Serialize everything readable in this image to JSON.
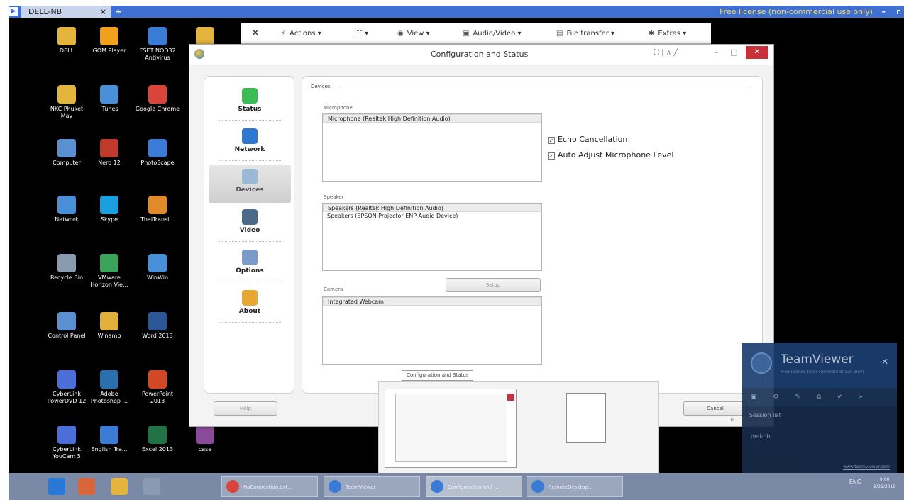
{
  "tv_bar": {
    "tab_label": "DELL-NB",
    "tab_close": "×",
    "new_tab": "+",
    "license_text": "Free license (non-commercial use only)",
    "minimize": "–",
    "maximize": "ñ"
  },
  "desktop_icons": [
    {
      "label": "DELL",
      "color": "#e4b53c"
    },
    {
      "label": "GOM Player",
      "color": "#f0a01a"
    },
    {
      "label": "ESET NOD32 Antivirus",
      "color": "#3a7bd5"
    },
    {
      "label": "",
      "color": "#e4b53c"
    },
    {
      "label": "NKC Phuket May",
      "color": "#e4b53c"
    },
    {
      "label": "iTunes",
      "color": "#4a90d9"
    },
    {
      "label": "Google Chrome",
      "color": "#d9453a"
    },
    {
      "label": "Computer",
      "color": "#5a8fd0"
    },
    {
      "label": "Nero 12",
      "color": "#c0392b"
    },
    {
      "label": "PhotoScape",
      "color": "#3a7bd5"
    },
    {
      "label": "Network",
      "color": "#4a90d9"
    },
    {
      "label": "Skype",
      "color": "#1a9fe0"
    },
    {
      "label": "ThaiTransl...",
      "color": "#e08a2a"
    },
    {
      "label": "Recycle Bin",
      "color": "#8a9bb0"
    },
    {
      "label": "VMware Horizon Vie...",
      "color": "#3aa55a"
    },
    {
      "label": "WinWin",
      "color": "#4a90d9"
    },
    {
      "label": "Control Panel",
      "color": "#5a8fd0"
    },
    {
      "label": "Winamp",
      "color": "#e0b03a"
    },
    {
      "label": "Word 2013",
      "color": "#2b5797"
    },
    {
      "label": "CyberLink PowerDVD 12",
      "color": "#4a6fd9"
    },
    {
      "label": "Adobe Photoshop ...",
      "color": "#2a6fb0"
    },
    {
      "label": "PowerPoint 2013",
      "color": "#d24726"
    },
    {
      "label": "CyberLink YouCam 5",
      "color": "#4a6fd9"
    },
    {
      "label": "English Tra...",
      "color": "#3a7bd5"
    },
    {
      "label": "Excel 2013",
      "color": "#217346"
    },
    {
      "label": "case",
      "color": "#8a4a9a"
    }
  ],
  "remote_toolbar": {
    "close": "✕",
    "actions": "Actions",
    "grid": "☷",
    "view": "View",
    "audio_video": "Audio/Video",
    "file_transfer": "File transfer",
    "extras": "Extras",
    "dropdown": "▾"
  },
  "dialog": {
    "title": "Configuration and Status",
    "title_extras": "⛶ | ∧ ╱",
    "minimize": "–",
    "maximize": "□",
    "close": "✕",
    "nav": [
      {
        "label": "Status",
        "color": "#3dbb55",
        "selected": false
      },
      {
        "label": "Network",
        "color": "#2f78d0",
        "selected": false
      },
      {
        "label": "Devices",
        "color": "#9ab8d8",
        "selected": true
      },
      {
        "label": "Video",
        "color": "#4a6a8a",
        "selected": false
      },
      {
        "label": "Options",
        "color": "#7a9ac8",
        "selected": false
      },
      {
        "label": "About",
        "color": "#e6a830",
        "selected": false
      }
    ],
    "devices": {
      "section_title": "Devices",
      "microphone_label": "Microphone",
      "microphones": [
        "Microphone (Realtek High Definition Audio)"
      ],
      "echo_cancellation": "Echo Cancellation",
      "auto_adjust": "Auto Adjust Microphone Level",
      "check_mark": "✓",
      "speaker_label": "Speaker",
      "speakers": [
        "Speakers (Realtek High Definition Audio)",
        "Speakers (EPSON Projector ENP Audio Device)"
      ],
      "setup_button": "Setup",
      "camera_label": "Camera",
      "cameras": [
        "Integrated Webcam"
      ]
    },
    "help_button": "Help",
    "cancel_button": "Cancel"
  },
  "preview": {
    "thumb_title": "Configuration and Status"
  },
  "tv_panel": {
    "brand": "TeamViewer",
    "subtitle": "Free license (non-commercial use only)",
    "close": "✕",
    "icons": "▣ ⚙ ✎ ⧉ ✔ »",
    "session_list": "Session list",
    "session_user": "dell-nb",
    "link": "www.teamviewer.com",
    "arrow": "▸"
  },
  "taskbar": {
    "tasks": [
      {
        "label": "NoConnection.ext...",
        "color": "#d9453a",
        "active": false
      },
      {
        "label": "TeamViewer",
        "color": "#3a7bd5",
        "active": false
      },
      {
        "label": "Configuration and ...",
        "color": "#3a7bd5",
        "active": true
      },
      {
        "label": "RemoteDesktop...",
        "color": "#3a7bd5",
        "active": false
      }
    ],
    "tray": "ENG",
    "time": "9:00",
    "date": "5/25/2016"
  }
}
